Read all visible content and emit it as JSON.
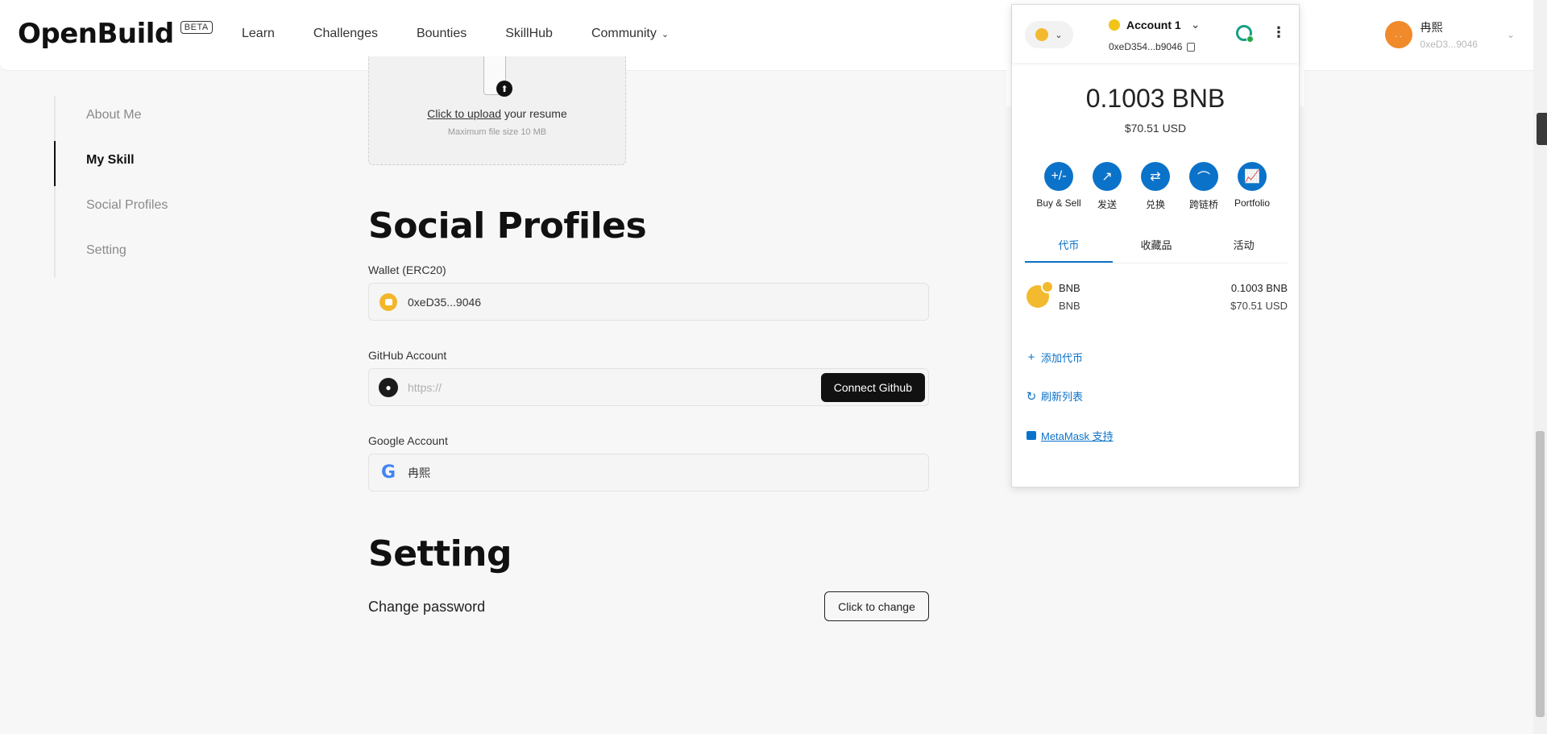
{
  "header": {
    "logo": "OpenBuild",
    "beta": "BETA",
    "nav": [
      {
        "label": "Learn"
      },
      {
        "label": "Challenges"
      },
      {
        "label": "Bounties"
      },
      {
        "label": "SkillHub"
      },
      {
        "label": "Community"
      }
    ],
    "user": {
      "name": "冉熙",
      "address": "0xeD3...9046",
      "avatar_text": ". ."
    }
  },
  "sidenav": {
    "items": [
      {
        "label": "About Me"
      },
      {
        "label": "My Skill"
      },
      {
        "label": "Social Profiles"
      },
      {
        "label": "Setting"
      }
    ],
    "active": "My Skill"
  },
  "upload": {
    "link": "Click to upload",
    "rest": " your resume",
    "sub": "Maximum file size 10 MB"
  },
  "social": {
    "title": "Social Profiles",
    "wallet_label": "Wallet (ERC20)",
    "wallet_value": "0xeD35...9046",
    "github_label": "GitHub Account",
    "github_placeholder": "https://",
    "github_button": "Connect Github",
    "google_label": "Google Account",
    "google_value": "冉熙"
  },
  "setting": {
    "title": "Setting",
    "password_label": "Change password",
    "password_button": "Click to change"
  },
  "metamask": {
    "account": "Account 1",
    "address": "0xeD354...b9046",
    "balance": "0.1003 BNB",
    "balance_usd": "$70.51 USD",
    "actions": [
      {
        "label": "Buy & Sell",
        "icon": "+/-"
      },
      {
        "label": "发送",
        "icon": "↗"
      },
      {
        "label": "兑换",
        "icon": "⇄"
      },
      {
        "label": "跨链桥",
        "icon": "⌒"
      },
      {
        "label": "Portfolio",
        "icon": "📈"
      }
    ],
    "tabs": [
      {
        "label": "代币"
      },
      {
        "label": "收藏品"
      },
      {
        "label": "活动"
      }
    ],
    "active_tab": "代币",
    "token": {
      "name": "BNB",
      "symbol": "BNB",
      "amount": "0.1003 BNB",
      "usd": "$70.51 USD"
    },
    "add_token": "添加代币",
    "refresh": "刷新列表",
    "support": "MetaMask 支持"
  },
  "colors": {
    "accent": "#0b72c9",
    "dark_button": "#111111",
    "bnb": "#f3ba2f"
  }
}
